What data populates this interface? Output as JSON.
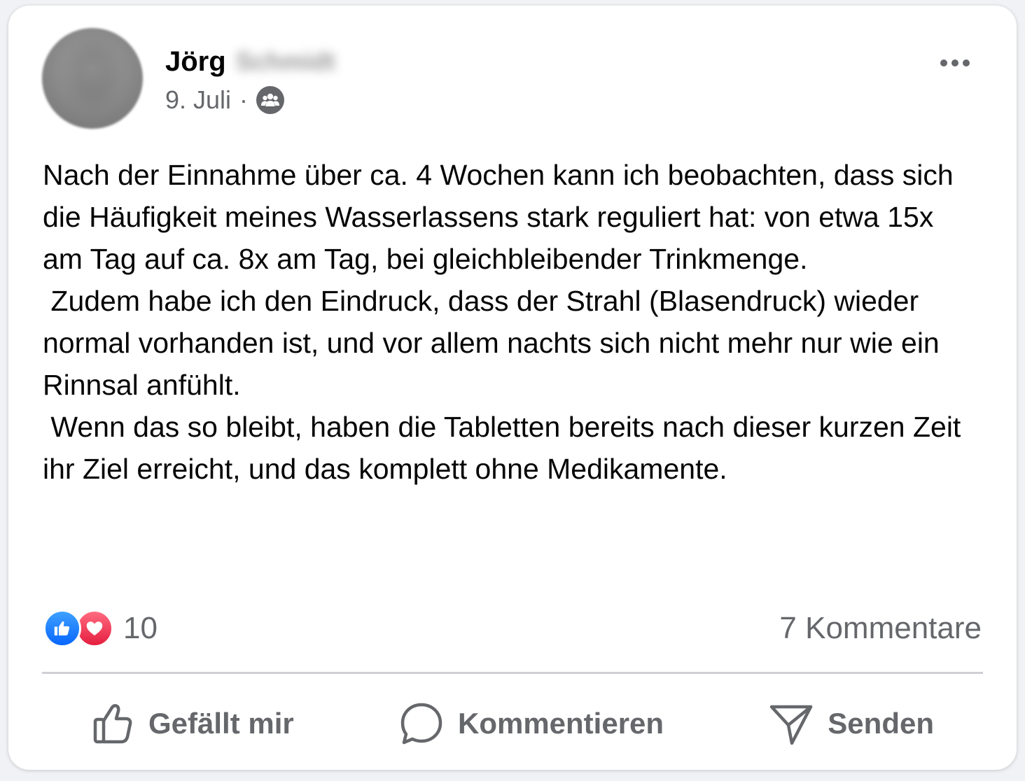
{
  "post": {
    "author_first": "Jörg",
    "author_last": "Schmidt",
    "date": "9. Juli",
    "separator": "·",
    "audience_icon": "group-icon",
    "more_icon": "more-horizontal-icon",
    "text": "Nach der Einnahme über ca. 4 Wochen kann ich beobachten, dass sich die Häufigkeit meines Wasserlassens stark reguliert hat: von etwa 15x am Tag auf ca. 8x am Tag, bei gleichbleibender Trinkmenge.\n Zudem habe ich den Eindruck, dass der Strahl (Blasendruck) wieder normal vorhanden ist, und vor allem nachts sich nicht mehr nur wie ein Rinnsal anfühlt.\n Wenn das so bleibt, haben die Tabletten bereits nach dieser kurzen Zeit ihr Ziel erreicht, und das komplett ohne Medikamente."
  },
  "stats": {
    "reactions_count": "10",
    "reaction_icons": [
      "like-icon",
      "love-icon"
    ],
    "comments": "7 Kommentare"
  },
  "actions": {
    "like_label": "Gefällt mir",
    "comment_label": "Kommentieren",
    "share_label": "Senden"
  },
  "colors": {
    "like": "#0866ff",
    "love": "#e41e3f",
    "secondary_text": "#65676b",
    "divider": "#ced0d4"
  }
}
